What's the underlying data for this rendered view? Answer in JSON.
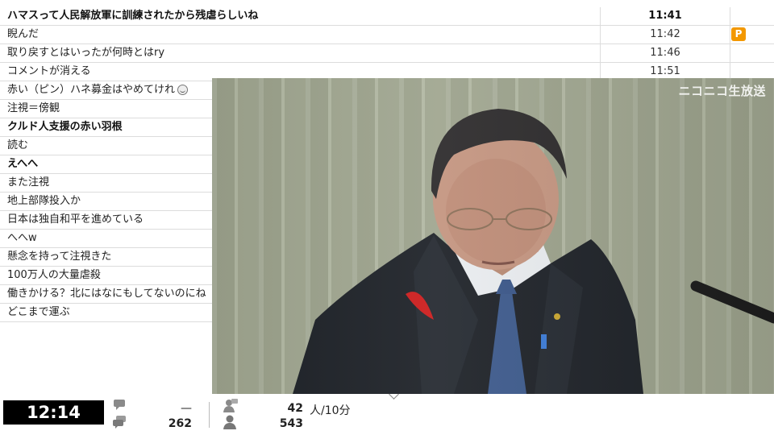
{
  "comments": [
    {
      "text": "ハマスって人民解放軍に訓練されたから残虐らしいね",
      "time": "11:41",
      "bold": true
    },
    {
      "text": "睨んだ",
      "time": "11:42",
      "premium": "P"
    },
    {
      "text": "取り戻すとはいったが何時とはry",
      "time": "11:46"
    },
    {
      "text": "コメントが消える",
      "time": "11:51"
    },
    {
      "text": "赤い（ピン）ハネ募金はやめてけれ",
      "emoji": "face-icon"
    },
    {
      "text": "注視＝傍観"
    },
    {
      "text": "クルド人支援の赤い羽根",
      "bold": true
    },
    {
      "text": "読む"
    },
    {
      "text": "えへへ",
      "bold": true
    },
    {
      "text": "また注視"
    },
    {
      "text": "地上部隊投入か"
    },
    {
      "text": "日本は独自和平を進めている"
    },
    {
      "text": "へへw"
    },
    {
      "text": "懸念を持って注視きた"
    },
    {
      "text": "100万人の大量虐殺"
    },
    {
      "text": "働きかける？北にはなにもしてないのにね"
    },
    {
      "text": "どこまで運ぶ"
    }
  ],
  "video": {
    "watermark": "ニコニコ生放送"
  },
  "status": {
    "time": "12:14",
    "comment_rate": "—",
    "comment_total": "262",
    "viewers_rate": "42",
    "viewers_rate_unit": "人/10分",
    "viewers_total": "543"
  },
  "colors": {
    "premium_badge": "#f39800",
    "clock_bg": "#000000"
  }
}
